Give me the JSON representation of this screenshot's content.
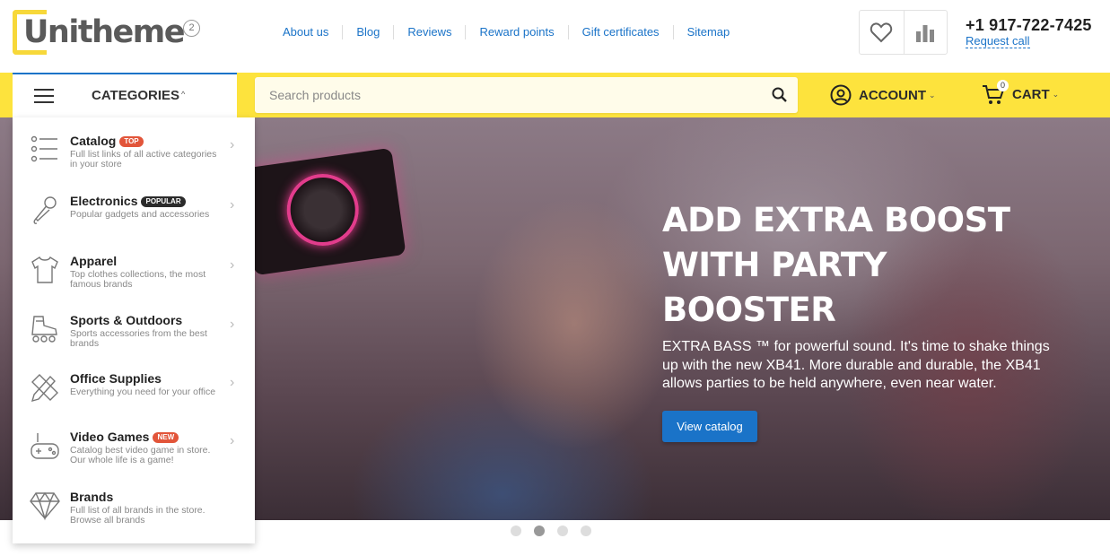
{
  "brand": {
    "logo_text": "Unitheme",
    "logo_badge": "2"
  },
  "topnav": [
    "About us",
    "Blog",
    "Reviews",
    "Reward points",
    "Gift certificates",
    "Sitemap"
  ],
  "header_icons": [
    "heart-icon",
    "bar-chart-icon"
  ],
  "contact": {
    "phone": "+1 917-722-7425",
    "request_call": "Request call"
  },
  "toolbar": {
    "categories_label": "CATEGORIES",
    "search_placeholder": "Search products",
    "account_label": "ACCOUNT",
    "cart_label": "CART",
    "cart_count": "0"
  },
  "colors": {
    "accent_yellow": "#fde33d",
    "link_blue": "#1a73c8",
    "badge_top": "#e2553a",
    "badge_popular": "#2b2b2b",
    "badge_new": "#e2553a"
  },
  "categories": [
    {
      "name": "Catalog",
      "badge": "TOP",
      "badge_color": "#e2553a",
      "desc": "Full list links of all active categories in your store",
      "icon": "list-icon"
    },
    {
      "name": "Electronics",
      "badge": "POPULAR",
      "badge_color": "#2b2b2b",
      "desc": "Popular gadgets and accessories",
      "icon": "microphone-icon"
    },
    {
      "name": "Apparel",
      "badge": "",
      "badge_color": "",
      "desc": "Top clothes collections, the most famous brands",
      "icon": "tshirt-icon"
    },
    {
      "name": "Sports & Outdoors",
      "badge": "",
      "badge_color": "",
      "desc": "Sports accessories from the best brands",
      "icon": "rollerskate-icon"
    },
    {
      "name": "Office Supplies",
      "badge": "",
      "badge_color": "",
      "desc": "Everything you need for your office",
      "icon": "pencil-ruler-icon"
    },
    {
      "name": "Video Games",
      "badge": "NEW",
      "badge_color": "#e2553a",
      "desc": "Catalog best video game in store. Our whole life is a game!",
      "icon": "gamepad-icon"
    },
    {
      "name": "Brands",
      "badge": "",
      "badge_color": "",
      "desc": "Full list of all brands in the store. Browse all brands",
      "icon": "diamond-icon"
    }
  ],
  "hero": {
    "title": "ADD EXTRA BOOST WITH PARTY BOOSTER",
    "text": "EXTRA BASS ™ for powerful sound. It's time to shake things up with the new XB41. More durable and durable, the XB41 allows parties to be held anywhere, even near water.",
    "button": "View catalog"
  },
  "slider": {
    "count": 4,
    "active_index": 1
  }
}
